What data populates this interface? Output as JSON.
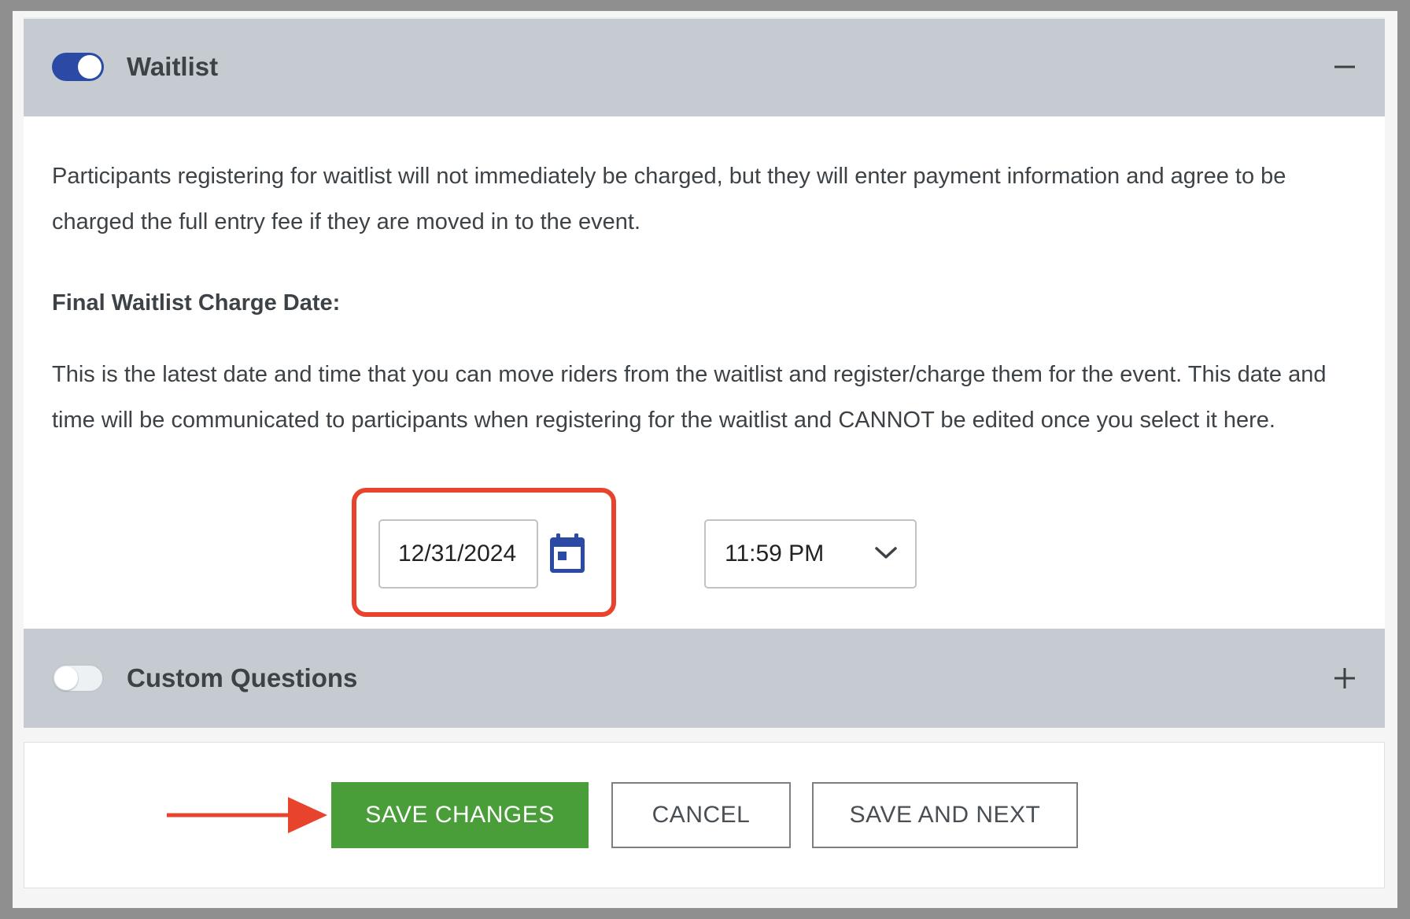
{
  "waitlist": {
    "title": "Waitlist",
    "toggle_on": true,
    "expander_symbol": "minus-icon",
    "description": "Participants registering for waitlist will not immediately be charged, but they will enter payment information and agree to be charged the full entry fee if they are moved in to the event.",
    "charge_date_label": "Final Waitlist Charge Date:",
    "charge_date_help": "This is the latest date and time that you can move riders from the waitlist and register/charge them for the event. This date and time will be communicated to participants when registering for the waitlist and CANNOT be edited once you select it here.",
    "date_value": "12/31/2024",
    "time_value": "11:59 PM"
  },
  "custom_questions": {
    "title": "Custom Questions",
    "toggle_on": false,
    "expander_symbol": "plus-icon"
  },
  "actions": {
    "save_changes": "SAVE CHANGES",
    "cancel": "CANCEL",
    "save_and_next": "SAVE AND NEXT"
  },
  "colors": {
    "toggle_on": "#2a4aa6",
    "primary_button": "#4a9e3a",
    "highlight": "#e8432d",
    "calendar_icon": "#2a4aa6"
  }
}
